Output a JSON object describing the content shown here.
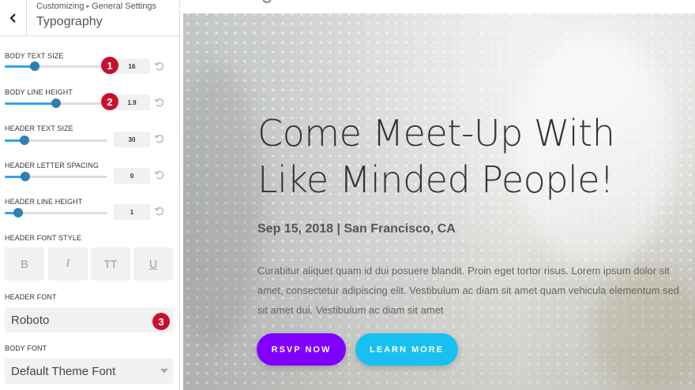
{
  "header": {
    "crumb_root": "Customizing",
    "crumb_child": "General Settings",
    "title": "Typography"
  },
  "controls": [
    {
      "label": "BODY TEXT SIZE",
      "value": "16",
      "level": 0.29
    },
    {
      "label": "BODY LINE HEIGHT",
      "value": "1.9",
      "level": 0.5
    },
    {
      "label": "HEADER TEXT SIZE",
      "value": "30",
      "level": 0.19
    },
    {
      "label": "HEADER LETTER SPACING",
      "value": "0",
      "level": 0.2
    },
    {
      "label": "HEADER LINE HEIGHT",
      "value": "1",
      "level": 0.13
    }
  ],
  "font_style": {
    "label": "HEADER FONT STYLE",
    "bold": "B",
    "italic": "I",
    "uppercase": "TT",
    "underline": "U"
  },
  "header_font": {
    "label": "HEADER FONT",
    "value": "Roboto"
  },
  "body_font": {
    "label": "BODY FONT",
    "value": "Default Theme Font"
  },
  "badges": [
    "1",
    "2",
    "3"
  ],
  "hero": {
    "title": "Come Meet-Up With Like Minded People!",
    "date": "Sep 15, 2018 | San Francisco, CA",
    "body": "Curabitur aliquet quam id dui posuere blandit. Proin eget tortor risus. Lorem ipsum dolor sit amet, consectetur adipiscing elit. Vestibulum ac diam sit amet quam vehicula elementum sed sit amet dui. Vestibulum ac diam sit amet",
    "rsvp": "RSVP NOW",
    "learn": "LEARN MORE"
  },
  "colors": {
    "accent": "#2ea3f2",
    "thumb": "#2f7fb0",
    "badge": "#c8102e",
    "rsvp": "#7f00ff",
    "learn": "#18c0f0"
  },
  "icons": {
    "back": "chevron-left-icon",
    "reset": "reset-arrow-icon",
    "dropdown": "caret-down-icon"
  }
}
